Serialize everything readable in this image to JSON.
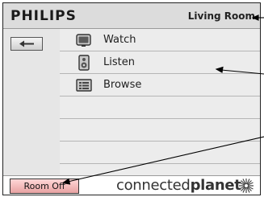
{
  "header": {
    "brand": "PHILIPS",
    "room_name": "Living Room"
  },
  "menu": {
    "items": [
      {
        "label": "Watch",
        "icon": "tv-icon"
      },
      {
        "label": "Listen",
        "icon": "speaker-icon"
      },
      {
        "label": "Browse",
        "icon": "list-icon"
      }
    ]
  },
  "footer": {
    "room_off_label": "Room Off",
    "logo_regular": "connected",
    "logo_bold": "planet"
  },
  "sidebar": {
    "back_icon": "back-arrow-icon"
  },
  "colors": {
    "room_off_fill": "#e8a2a2",
    "frame_bg": "#e4e4e4"
  }
}
